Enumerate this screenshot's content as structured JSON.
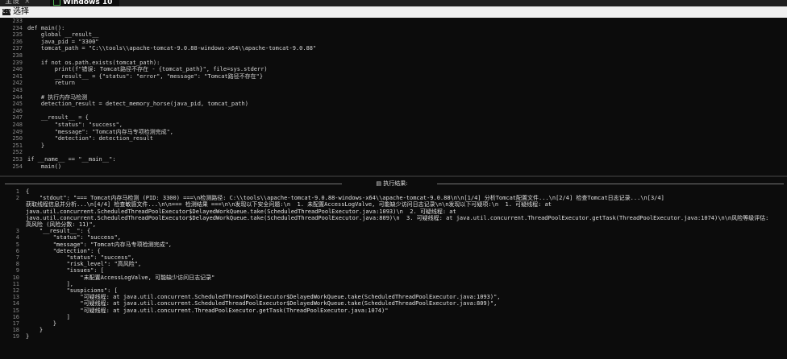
{
  "tabs": [
    {
      "label": "全设"
    },
    {
      "label": "Windows 10 x64"
    }
  ],
  "window": {
    "title": "选择",
    "icon_text": "C:\\"
  },
  "editor_lines": [
    {
      "n": "233",
      "t": ""
    },
    {
      "n": "234",
      "t": "def main():"
    },
    {
      "n": "235",
      "t": "    global __result__"
    },
    {
      "n": "236",
      "t": "    java_pid = \"3300\""
    },
    {
      "n": "237",
      "t": "    tomcat_path = \"C:\\\\tools\\\\apache-tomcat-9.0.88-windows-x64\\\\apache-tomcat-9.0.88\""
    },
    {
      "n": "238",
      "t": ""
    },
    {
      "n": "239",
      "t": "    if not os.path.exists(tomcat_path):"
    },
    {
      "n": "240",
      "t": "        print(f\"错误: Tomcat路径不存在 - {tomcat_path}\", file=sys.stderr)"
    },
    {
      "n": "241",
      "t": "        __result__ = {\"status\": \"error\", \"message\": \"Tomcat路径不存在\"}"
    },
    {
      "n": "242",
      "t": "        return"
    },
    {
      "n": "243",
      "t": ""
    },
    {
      "n": "244",
      "t": "    # 执行内存马检测"
    },
    {
      "n": "245",
      "t": "    detection_result = detect_memory_horse(java_pid, tomcat_path)"
    },
    {
      "n": "246",
      "t": ""
    },
    {
      "n": "247",
      "t": "    __result__ = {"
    },
    {
      "n": "248",
      "t": "        \"status\": \"success\","
    },
    {
      "n": "249",
      "t": "        \"message\": \"Tomcat内存马专项检测完成\","
    },
    {
      "n": "250",
      "t": "        \"detection\": detection_result"
    },
    {
      "n": "251",
      "t": "    }"
    },
    {
      "n": "252",
      "t": ""
    },
    {
      "n": "253",
      "t": "if __name__ == \"__main__\":"
    },
    {
      "n": "254",
      "t": "    main()"
    }
  ],
  "result_header": "▤ 执行结果:",
  "output_lines": [
    {
      "n": "1",
      "t": "{"
    },
    {
      "n": "2",
      "t": "    \"stdout\": \"=== Tomcat内存马检测 (PID: 3300) ===\\n检测路径: C:\\\\tools\\\\apache-tomcat-9.0.88-windows-x64\\\\apache-tomcat-9.0.88\\n\\n[1/4] 分析Tomcat配置文件...\\n[2/4] 检查Tomcat日志记录...\\n[3/4]"
    },
    {
      "n": "",
      "t": "获取线程信息并分析...\\n[4/4] 检查敏感文件...\\n\\n=== 检测结果 ===\\n\\n发现以下安全问题:\\n  1. 未配置AccessLogValve, 可能缺少访问日志记录\\n\\n发现以下可疑项:\\n  1. 可疑线程: at"
    },
    {
      "n": "",
      "t": "java.util.concurrent.ScheduledThreadPoolExecutor$DelayedWorkQueue.take(ScheduledThreadPoolExecutor.java:1093)\\n  2. 可疑线程: at"
    },
    {
      "n": "",
      "t": "java.util.concurrent.ScheduledThreadPoolExecutor$DelayedWorkQueue.take(ScheduledThreadPoolExecutor.java:809)\\n  3. 可疑线程: at java.util.concurrent.ThreadPoolExecutor.getTask(ThreadPoolExecutor.java:1074)\\n\\n风险等级评估:"
    },
    {
      "n": "",
      "t": "高风险 (风险分数: 11)\","
    },
    {
      "n": "3",
      "t": "    \"__result__\": {"
    },
    {
      "n": "4",
      "t": "        \"status\": \"success\","
    },
    {
      "n": "5",
      "t": "        \"message\": \"Tomcat内存马专项检测完成\","
    },
    {
      "n": "6",
      "t": "        \"detection\": {"
    },
    {
      "n": "7",
      "t": "            \"status\": \"success\","
    },
    {
      "n": "8",
      "t": "            \"risk_level\": \"高风险\","
    },
    {
      "n": "9",
      "t": "            \"issues\": ["
    },
    {
      "n": "10",
      "t": "                \"未配置AccessLogValve, 可能缺少访问日志记录\""
    },
    {
      "n": "11",
      "t": "            ],"
    },
    {
      "n": "12",
      "t": "            \"suspicions\": ["
    },
    {
      "n": "13",
      "t": "                \"可疑线程: at java.util.concurrent.ScheduledThreadPoolExecutor$DelayedWorkQueue.take(ScheduledThreadPoolExecutor.java:1093)\","
    },
    {
      "n": "14",
      "t": "                \"可疑线程: at java.util.concurrent.ScheduledThreadPoolExecutor$DelayedWorkQueue.take(ScheduledThreadPoolExecutor.java:809)\","
    },
    {
      "n": "15",
      "t": "                \"可疑线程: at java.util.concurrent.ThreadPoolExecutor.getTask(ThreadPoolExecutor.java:1074)\""
    },
    {
      "n": "16",
      "t": "            ]"
    },
    {
      "n": "17",
      "t": "        }"
    },
    {
      "n": "18",
      "t": "    }"
    },
    {
      "n": "19",
      "t": "}"
    }
  ]
}
